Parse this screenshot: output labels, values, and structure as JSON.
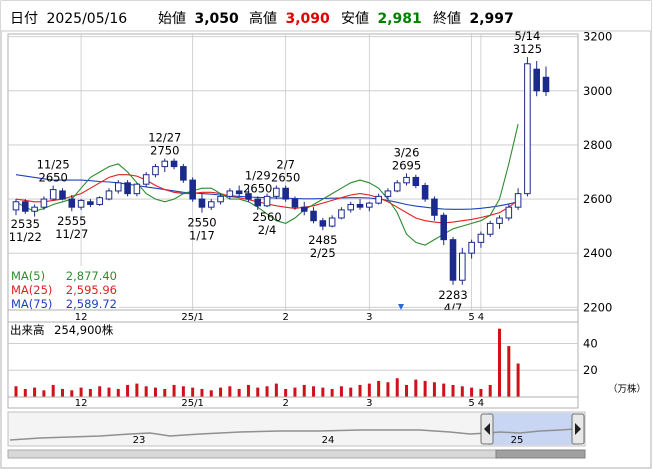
{
  "header": {
    "date_label": "日付",
    "date": "2025/05/16",
    "open_label": "始値",
    "open": "3,050",
    "high_label": "高値",
    "high": "3,090",
    "low_label": "安値",
    "low": "2,981",
    "close_label": "終値",
    "close": "2,997"
  },
  "colors": {
    "high": "#e00000",
    "low": "#008000",
    "up_candle": "#ffffff",
    "down_candle": "#1b2a8c",
    "ma5": "#2e8b2e",
    "ma25": "#e02020",
    "ma75": "#2040c0",
    "volume": "#d0101a",
    "grid": "#c8c8c8"
  },
  "legend": [
    {
      "name": "MA(5)",
      "value": "2,877.40"
    },
    {
      "name": "MA(25)",
      "value": "2,595.96"
    },
    {
      "name": "MA(75)",
      "value": "2,589.72"
    }
  ],
  "volume_label": "出来高",
  "volume_value": "254,900株",
  "volume_unit": "（万株）",
  "navigator": {
    "labels": [
      "23",
      "24",
      "25"
    ]
  },
  "chart_data": {
    "type": "candlestick",
    "y_ticks": [
      "3200",
      "3000",
      "2800",
      "2600",
      "2400",
      "2200"
    ],
    "ylim": [
      2190,
      3210
    ],
    "x_ticks": [
      "12",
      "25/1",
      "2",
      "3",
      "4",
      "5"
    ],
    "volume_ticks": [
      "40",
      "20"
    ],
    "volume_ylim": [
      0,
      53
    ],
    "annotations": [
      {
        "date": "11/22",
        "value": "2535",
        "position": "below"
      },
      {
        "date": "11/25",
        "value": "2650",
        "position": "above"
      },
      {
        "date": "11/27",
        "value": "2555",
        "position": "below"
      },
      {
        "date": "12/27",
        "value": "2750",
        "position": "above"
      },
      {
        "date": "1/17",
        "value": "2550",
        "position": "below"
      },
      {
        "date": "1/29",
        "value": "2650",
        "position": "above"
      },
      {
        "date": "2/4",
        "value": "2560",
        "position": "below"
      },
      {
        "date": "2/7",
        "value": "2650",
        "position": "above"
      },
      {
        "date": "2/25",
        "value": "2485",
        "position": "below"
      },
      {
        "date": "3/26",
        "value": "2695",
        "position": "above"
      },
      {
        "date": "4/7",
        "value": "2283",
        "position": "below"
      },
      {
        "date": "5/14",
        "value": "3125",
        "position": "above"
      }
    ],
    "ma5": [
      2590,
      2570,
      2555,
      2565,
      2580,
      2590,
      2600,
      2640,
      2680,
      2700,
      2720,
      2730,
      2700,
      2660,
      2620,
      2600,
      2590,
      2600,
      2620,
      2630,
      2640,
      2640,
      2620,
      2600,
      2600,
      2590,
      2570,
      2545,
      2520,
      2510,
      2530,
      2560,
      2580,
      2600,
      2620,
      2640,
      2660,
      2670,
      2660,
      2640,
      2600,
      2550,
      2470,
      2440,
      2430,
      2450,
      2470,
      2490,
      2500,
      2510,
      2520,
      2540,
      2600,
      2730,
      2877
    ],
    "ma25": [
      2600,
      2595,
      2590,
      2590,
      2595,
      2600,
      2610,
      2620,
      2640,
      2660,
      2680,
      2690,
      2690,
      2685,
      2670,
      2650,
      2635,
      2625,
      2620,
      2620,
      2625,
      2625,
      2620,
      2610,
      2605,
      2598,
      2590,
      2582,
      2575,
      2570,
      2565,
      2570,
      2575,
      2585,
      2595,
      2605,
      2615,
      2620,
      2615,
      2605,
      2590,
      2570,
      2550,
      2530,
      2520,
      2515,
      2512,
      2515,
      2520,
      2525,
      2532,
      2540,
      2550,
      2570,
      2596
    ],
    "ma75": [
      2690,
      2685,
      2680,
      2675,
      2670,
      2670,
      2670,
      2670,
      2668,
      2665,
      2663,
      2660,
      2655,
      2650,
      2645,
      2640,
      2635,
      2630,
      2625,
      2622,
      2620,
      2618,
      2615,
      2612,
      2610,
      2608,
      2606,
      2605,
      2604,
      2603,
      2602,
      2601,
      2601,
      2602,
      2603,
      2604,
      2605,
      2605,
      2604,
      2600,
      2595,
      2588,
      2580,
      2574,
      2570,
      2566,
      2563,
      2562,
      2562,
      2563,
      2566,
      2570,
      2575,
      2582,
      2590
    ],
    "candles": [
      {
        "o": 2560,
        "h": 2600,
        "l": 2540,
        "c": 2590
      },
      {
        "o": 2590,
        "h": 2600,
        "l": 2545,
        "c": 2555
      },
      {
        "o": 2555,
        "h": 2580,
        "l": 2535,
        "c": 2570
      },
      {
        "o": 2570,
        "h": 2610,
        "l": 2560,
        "c": 2600
      },
      {
        "o": 2600,
        "h": 2650,
        "l": 2595,
        "c": 2635
      },
      {
        "o": 2630,
        "h": 2640,
        "l": 2595,
        "c": 2600
      },
      {
        "o": 2600,
        "h": 2615,
        "l": 2555,
        "c": 2570
      },
      {
        "o": 2570,
        "h": 2600,
        "l": 2560,
        "c": 2595
      },
      {
        "o": 2590,
        "h": 2600,
        "l": 2570,
        "c": 2580
      },
      {
        "o": 2580,
        "h": 2610,
        "l": 2575,
        "c": 2605
      },
      {
        "o": 2600,
        "h": 2640,
        "l": 2595,
        "c": 2630
      },
      {
        "o": 2630,
        "h": 2670,
        "l": 2620,
        "c": 2660
      },
      {
        "o": 2660,
        "h": 2670,
        "l": 2610,
        "c": 2620
      },
      {
        "o": 2620,
        "h": 2660,
        "l": 2610,
        "c": 2655
      },
      {
        "o": 2655,
        "h": 2700,
        "l": 2645,
        "c": 2690
      },
      {
        "o": 2690,
        "h": 2730,
        "l": 2680,
        "c": 2720
      },
      {
        "o": 2720,
        "h": 2750,
        "l": 2700,
        "c": 2740
      },
      {
        "o": 2740,
        "h": 2750,
        "l": 2710,
        "c": 2720
      },
      {
        "o": 2720,
        "h": 2730,
        "l": 2660,
        "c": 2670
      },
      {
        "o": 2670,
        "h": 2680,
        "l": 2590,
        "c": 2600
      },
      {
        "o": 2600,
        "h": 2620,
        "l": 2550,
        "c": 2570
      },
      {
        "o": 2570,
        "h": 2600,
        "l": 2560,
        "c": 2590
      },
      {
        "o": 2590,
        "h": 2620,
        "l": 2580,
        "c": 2610
      },
      {
        "o": 2610,
        "h": 2640,
        "l": 2600,
        "c": 2630
      },
      {
        "o": 2630,
        "h": 2650,
        "l": 2610,
        "c": 2620
      },
      {
        "o": 2620,
        "h": 2640,
        "l": 2590,
        "c": 2600
      },
      {
        "o": 2600,
        "h": 2610,
        "l": 2560,
        "c": 2575
      },
      {
        "o": 2575,
        "h": 2620,
        "l": 2570,
        "c": 2610
      },
      {
        "o": 2610,
        "h": 2650,
        "l": 2600,
        "c": 2640
      },
      {
        "o": 2640,
        "h": 2650,
        "l": 2590,
        "c": 2600
      },
      {
        "o": 2600,
        "h": 2610,
        "l": 2560,
        "c": 2570
      },
      {
        "o": 2570,
        "h": 2590,
        "l": 2540,
        "c": 2555
      },
      {
        "o": 2555,
        "h": 2570,
        "l": 2510,
        "c": 2520
      },
      {
        "o": 2520,
        "h": 2530,
        "l": 2485,
        "c": 2500
      },
      {
        "o": 2500,
        "h": 2540,
        "l": 2495,
        "c": 2530
      },
      {
        "o": 2530,
        "h": 2570,
        "l": 2525,
        "c": 2560
      },
      {
        "o": 2560,
        "h": 2590,
        "l": 2550,
        "c": 2580
      },
      {
        "o": 2580,
        "h": 2600,
        "l": 2560,
        "c": 2570
      },
      {
        "o": 2570,
        "h": 2590,
        "l": 2555,
        "c": 2585
      },
      {
        "o": 2585,
        "h": 2620,
        "l": 2580,
        "c": 2610
      },
      {
        "o": 2610,
        "h": 2640,
        "l": 2600,
        "c": 2630
      },
      {
        "o": 2630,
        "h": 2670,
        "l": 2625,
        "c": 2660
      },
      {
        "o": 2660,
        "h": 2695,
        "l": 2650,
        "c": 2680
      },
      {
        "o": 2680,
        "h": 2690,
        "l": 2640,
        "c": 2650
      },
      {
        "o": 2650,
        "h": 2660,
        "l": 2590,
        "c": 2600
      },
      {
        "o": 2600,
        "h": 2610,
        "l": 2520,
        "c": 2540
      },
      {
        "o": 2540,
        "h": 2550,
        "l": 2430,
        "c": 2450
      },
      {
        "o": 2450,
        "h": 2460,
        "l": 2283,
        "c": 2300
      },
      {
        "o": 2300,
        "h": 2420,
        "l": 2283,
        "c": 2400
      },
      {
        "o": 2400,
        "h": 2450,
        "l": 2380,
        "c": 2440
      },
      {
        "o": 2440,
        "h": 2480,
        "l": 2420,
        "c": 2470
      },
      {
        "o": 2470,
        "h": 2520,
        "l": 2460,
        "c": 2510
      },
      {
        "o": 2510,
        "h": 2540,
        "l": 2490,
        "c": 2530
      },
      {
        "o": 2530,
        "h": 2580,
        "l": 2520,
        "c": 2570
      },
      {
        "o": 2570,
        "h": 2640,
        "l": 2560,
        "c": 2620
      },
      {
        "o": 2620,
        "h": 3125,
        "l": 2610,
        "c": 3100
      },
      {
        "o": 3080,
        "h": 3110,
        "l": 2980,
        "c": 3000
      },
      {
        "o": 3050,
        "h": 3090,
        "l": 2981,
        "c": 2997
      }
    ],
    "volume": [
      8,
      6,
      7,
      5,
      9,
      6,
      5,
      7,
      6,
      8,
      7,
      6,
      9,
      10,
      8,
      7,
      6,
      9,
      8,
      7,
      6,
      5,
      7,
      8,
      6,
      9,
      7,
      8,
      10,
      6,
      7,
      9,
      8,
      7,
      6,
      8,
      7,
      9,
      10,
      12,
      11,
      14,
      9,
      13,
      12,
      11,
      10,
      9,
      8,
      7,
      6,
      9,
      51,
      38,
      25
    ]
  }
}
